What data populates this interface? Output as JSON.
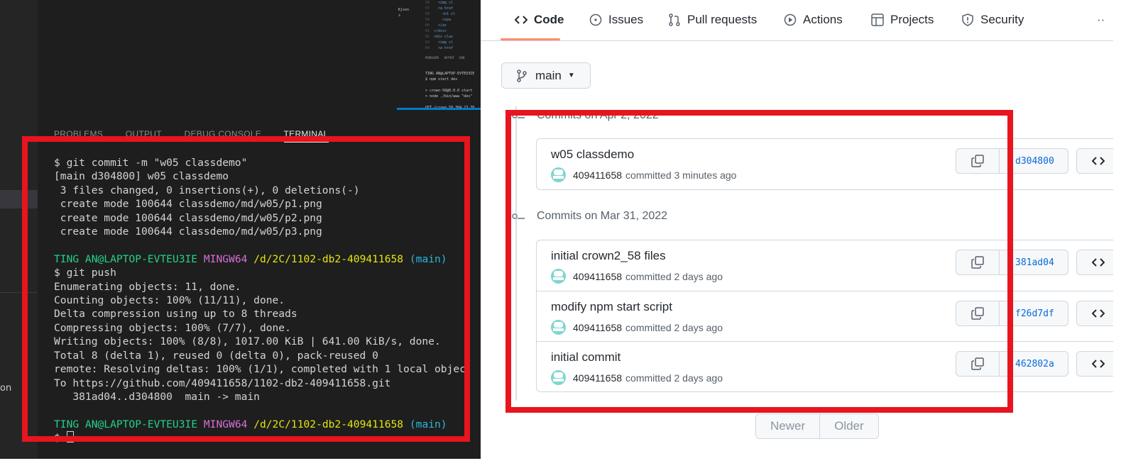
{
  "vscode": {
    "panel_tabs": [
      "PROBLEMS",
      "OUTPUT",
      "DEBUG CONSOLE",
      "TERMINAL"
    ],
    "active_panel_tab": "TERMINAL",
    "sidebar_text": "on",
    "thumbnail": {
      "kjson": "Kjson\ns",
      "line_numbers": "56\n57\n58\n59\n60\n61\n62\n63\n64",
      "code": "  <img cl\n  <a href\n    <h1 cl\n    <spa\n  </a>\n</div>\n<div clas\n  <img cl\n  <a href",
      "tabs": "PROBLEMS   OUTPUT   DEB",
      "terminal": "TING AN@LAPTOP-EVTEU3IE\n$ npm start dev\n\n> crown-58@0.0.0 start\n> node ./bin/www \"dev\"\n\nGET /crown_58 304 23.70"
    },
    "terminal": {
      "lines": [
        "$ git commit -m \"w05 classdemo\"",
        "[main d304800] w05 classdemo",
        " 3 files changed, 0 insertions(+), 0 deletions(-)",
        " create mode 100644 classdemo/md/w05/p1.png",
        " create mode 100644 classdemo/md/w05/p2.png",
        " create mode 100644 classdemo/md/w05/p3.png"
      ],
      "prompt": {
        "user": "TING AN@LAPTOP-EVTEU3IE",
        "shell": "MINGW64",
        "path": "/d/2C/1102-db2-409411658",
        "branch": "(main)"
      },
      "push_cmd": "$ git push",
      "push_output": [
        "Enumerating objects: 11, done.",
        "Counting objects: 100% (11/11), done.",
        "Delta compression using up to 8 threads",
        "Compressing objects: 100% (7/7), done.",
        "Writing objects: 100% (8/8), 1017.00 KiB | 641.00 KiB/s, done.",
        "Total 8 (delta 1), reused 0 (delta 0), pack-reused 0",
        "remote: Resolving deltas: 100% (1/1), completed with 1 local objec.",
        "To https://github.com/409411658/1102-db2-409411658.git",
        "   381ad04..d304800  main -> main"
      ],
      "last_line": "$ "
    }
  },
  "github": {
    "nav": {
      "code": "Code",
      "issues": "Issues",
      "pull_requests": "Pull requests",
      "actions": "Actions",
      "projects": "Projects",
      "security": "Security",
      "more": "··"
    },
    "branch": "main",
    "groups": [
      {
        "title": "Commits on Apr 2, 2022",
        "commits": [
          {
            "message": "w05 classdemo",
            "author": "409411658",
            "time": "committed 3 minutes ago",
            "sha": "d304800"
          }
        ]
      },
      {
        "title": "Commits on Mar 31, 2022",
        "commits": [
          {
            "message": "initial crown2_58 files",
            "author": "409411658",
            "time": "committed 2 days ago",
            "sha": "381ad04"
          },
          {
            "message": "modify npm start script",
            "author": "409411658",
            "time": "committed 2 days ago",
            "sha": "f26d7df"
          },
          {
            "message": "initial commit",
            "author": "409411658",
            "time": "committed 2 days ago",
            "sha": "462802a"
          }
        ]
      }
    ],
    "pagination": {
      "newer": "Newer",
      "older": "Older"
    }
  },
  "colors": {
    "highlight": "#e8141e",
    "link": "#0969da",
    "active_underline": "#fd8c73"
  }
}
